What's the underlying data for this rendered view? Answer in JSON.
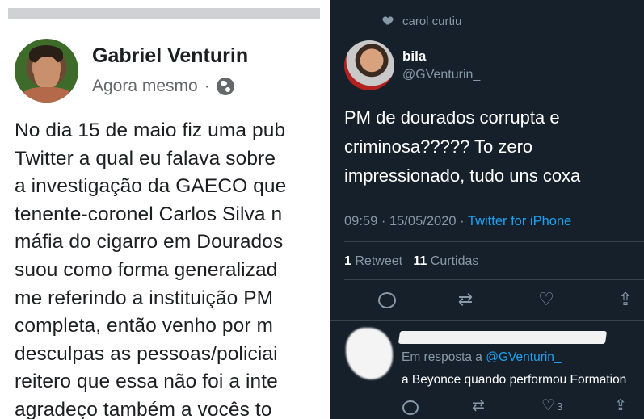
{
  "facebook": {
    "author": "Gabriel Venturin",
    "time": "Agora mesmo",
    "separator": "·",
    "audience_icon": "globe-icon",
    "body_lines": [
      "No dia 15 de maio fiz uma pub",
      "Twitter a qual eu falava sobre",
      "a investigação da GAECO que",
      "tenente-coronel Carlos Silva n",
      "máfia do cigarro em Dourados",
      "suou como forma generalizad",
      "me referindo a instituição PM",
      "completa, então venho por m",
      "desculpas as pessoas/policiai",
      "reitero que essa não foi a inte",
      "agradeço também a vocês to"
    ]
  },
  "twitter": {
    "liked_by": "carol curtiu",
    "liked_icon": "heart-icon",
    "name": "bila",
    "handle": "@GVenturin_",
    "text_lines": [
      "PM de dourados corrupta e",
      "criminosa????? To zero",
      "impressionado, tudo uns coxa"
    ],
    "time": "09:59 · 15/05/2020 ·",
    "source": "Twitter for iPhone",
    "retweet_count": "1",
    "retweet_label": "Retweet",
    "like_count": "11",
    "like_label": "Curtidas",
    "actions": {
      "retweet_glyph": "⇄",
      "like_glyph": "♡",
      "share_glyph": "⇪"
    },
    "reply": {
      "in_reply_prefix": "Em resposta a",
      "in_reply_handle": "@GVenturin_",
      "text": "a Beyonce quando performou Formation",
      "like_count": "3",
      "retweet_glyph": "⇄",
      "like_glyph": "♡",
      "share_glyph": "⇪"
    }
  },
  "colors": {
    "twitter_bg": "#15202b",
    "twitter_blue": "#1da1f2",
    "muted": "#8899a6",
    "fb_text": "#1c1e21"
  }
}
